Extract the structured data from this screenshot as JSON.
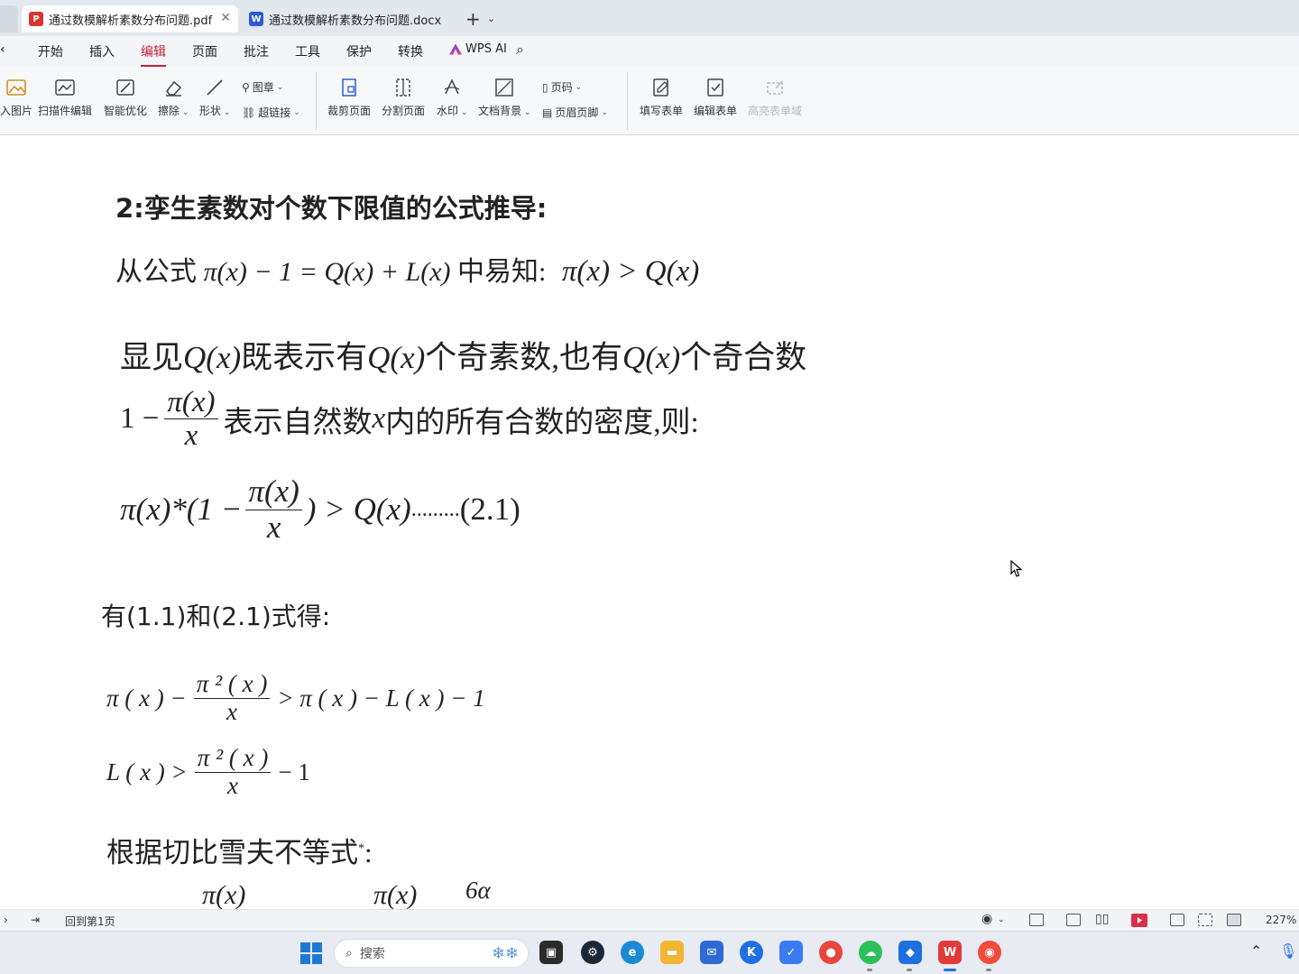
{
  "tabs": [
    {
      "label": "通过数模解析素数分布问题.pdf",
      "type": "pdf",
      "active": true
    },
    {
      "label": "通过数模解析素数分布问题.docx",
      "type": "docx",
      "active": false
    }
  ],
  "menu": [
    "开始",
    "插入",
    "编辑",
    "页面",
    "批注",
    "工具",
    "保护",
    "转换"
  ],
  "menu_active": "编辑",
  "wps_ai": "WPS AI",
  "ribbon": {
    "insert_image": "入图片",
    "scan_edit": "扫描件编辑",
    "smart_opt": "智能优化",
    "erase": "擦除",
    "shape": "形状",
    "stamp": "图章",
    "hyperlink": "超链接",
    "crop_page": "裁剪页面",
    "split_page": "分割页面",
    "watermark": "水印",
    "doc_bg": "文档背景",
    "page_num": "页码",
    "header_footer": "页眉页脚",
    "fill_form": "填写表单",
    "edit_form": "编辑表单",
    "highlight_form": "高亮表单域"
  },
  "doc": {
    "heading": "2:孪生素数对个数下限值的公式推导:",
    "l1_pre": "从公式",
    "l1_formula": "π(x) − 1 = Q(x) + L(x)",
    "l1_mid": "中易知:",
    "l1_ineq": "π(x) > Q(x)",
    "l2_a": "显见",
    "l2_q": "Q(x)",
    "l2_b": "既表示有",
    "l2_c": "个奇素数,也有",
    "l2_d": "个奇合数",
    "l3_one": "1 −",
    "frac_num": "π(x)",
    "frac_den": "x",
    "l3_text_a": "表示自然数",
    "l3_x": "x",
    "l3_text_b": "内的所有合数的密度,则:",
    "l4_pre": "π(x)*(1 −",
    "l4_post": ") > Q(x)",
    "l4_dots": ".........",
    "l4_tag": "(2.1)",
    "l5": "有(1.1)和(2.1)式得:",
    "l6_pre": "π ( x ) −",
    "l6_num": "π ² ( x )",
    "l6_den": "x",
    "l6_post": "> π ( x ) − L ( x ) − 1",
    "l7_pre": "L ( x ) >",
    "l7_num": "π ² ( x )",
    "l7_den": "x",
    "l7_post": "− 1",
    "l8": "根据切比雪夫不等式",
    "l8_star": "*",
    "l8_colon": ":",
    "l9_num_a": "π(x)",
    "l9_num_b": "π(x)",
    "l9_num_c": "6α"
  },
  "status": {
    "goto_first": "回到第1页",
    "zoom": "227%"
  },
  "taskbar": {
    "search_placeholder": "搜索"
  },
  "colors": {
    "accent": "#c4213a",
    "pdf_icon": "#d8342c",
    "docx_icon": "#2a5bd7"
  }
}
